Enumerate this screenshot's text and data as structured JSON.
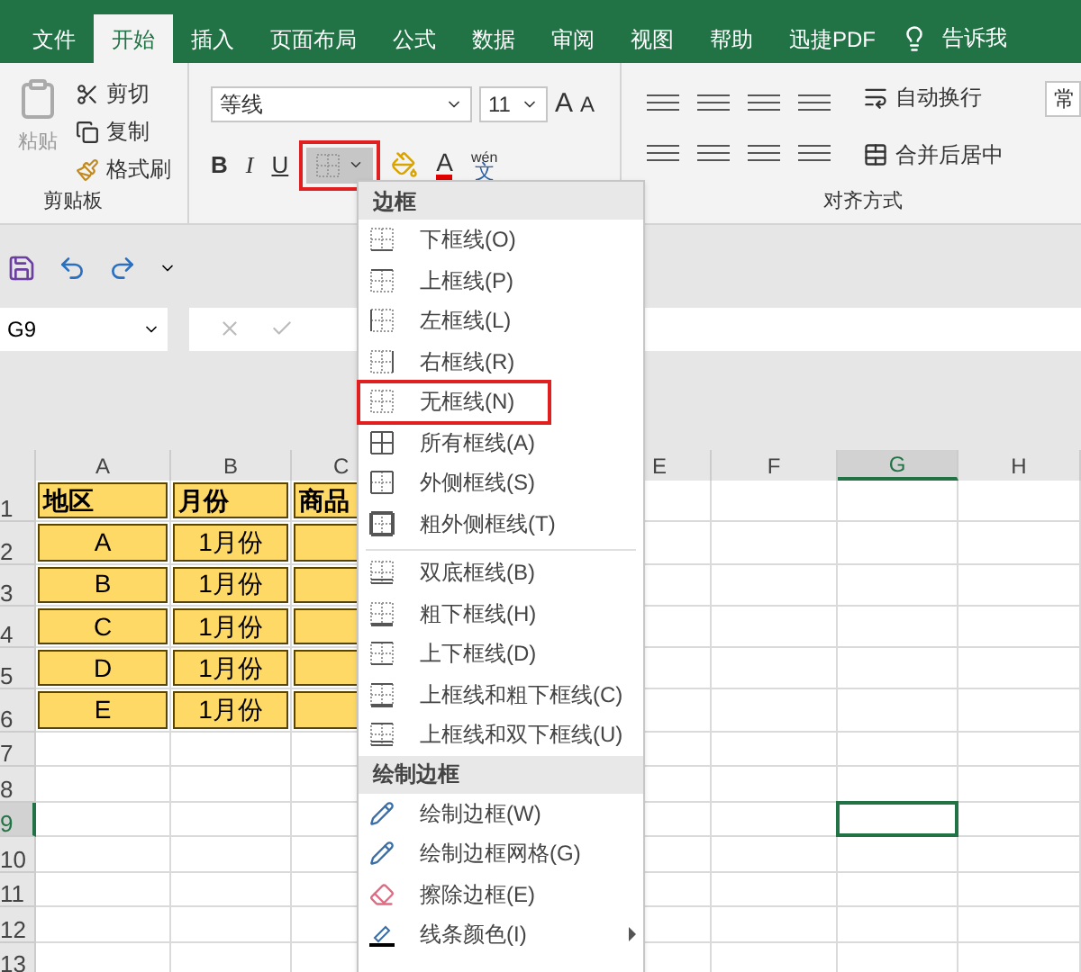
{
  "tabs": [
    {
      "label": "文件",
      "selected": false
    },
    {
      "label": "开始",
      "selected": true
    },
    {
      "label": "插入",
      "selected": false
    },
    {
      "label": "页面布局",
      "selected": false
    },
    {
      "label": "公式",
      "selected": false
    },
    {
      "label": "数据",
      "selected": false
    },
    {
      "label": "审阅",
      "selected": false
    },
    {
      "label": "视图",
      "selected": false
    },
    {
      "label": "帮助",
      "selected": false
    },
    {
      "label": "迅捷PDF",
      "selected": false
    }
  ],
  "tell_me": "告诉我",
  "ribbon": {
    "clipboard": {
      "paste": "粘贴",
      "cut": "剪切",
      "copy": "复制",
      "format_painter": "格式刷",
      "label": "剪贴板"
    },
    "font": {
      "name": "等线",
      "size": "11",
      "grow": "A",
      "shrink": "A",
      "bold": "B",
      "italic": "I",
      "underline": "U",
      "font_color": "A",
      "phonetic_top": "wén",
      "phonetic": "文",
      "border_highlighted": true
    },
    "alignment": {
      "wrap": "自动换行",
      "merge": "合并后居中",
      "label": "对齐方式"
    },
    "next_group": "常"
  },
  "name_box": "G9",
  "columns": [
    {
      "label": "A",
      "selected": false
    },
    {
      "label": "B",
      "selected": false
    },
    {
      "label": "C",
      "selected": false
    },
    {
      "label": "E",
      "selected": false
    },
    {
      "label": "F",
      "selected": false
    },
    {
      "label": "G",
      "selected": true
    },
    {
      "label": "H",
      "selected": false
    }
  ],
  "rows": [
    {
      "label": "1",
      "selected": false,
      "cells": [
        "地区",
        "月份",
        "商品"
      ]
    },
    {
      "label": "2",
      "selected": false,
      "cells": [
        "A",
        "1月份",
        ""
      ]
    },
    {
      "label": "3",
      "selected": false,
      "cells": [
        "B",
        "1月份",
        ""
      ]
    },
    {
      "label": "4",
      "selected": false,
      "cells": [
        "C",
        "1月份",
        ""
      ]
    },
    {
      "label": "5",
      "selected": false,
      "cells": [
        "D",
        "1月份",
        ""
      ]
    },
    {
      "label": "6",
      "selected": false,
      "cells": [
        "E",
        "1月份",
        ""
      ]
    },
    {
      "label": "7",
      "selected": false,
      "cells": []
    },
    {
      "label": "8",
      "selected": false,
      "cells": []
    },
    {
      "label": "9",
      "selected": true,
      "cells": []
    },
    {
      "label": "10",
      "selected": false,
      "cells": []
    },
    {
      "label": "11",
      "selected": false,
      "cells": []
    },
    {
      "label": "12",
      "selected": false,
      "cells": []
    },
    {
      "label": "13",
      "selected": false,
      "cells": []
    }
  ],
  "border_menu": [
    {
      "kind": "header",
      "label": "边框"
    },
    {
      "kind": "bottom",
      "label": "下框线(O)",
      "highlighted": false
    },
    {
      "kind": "top",
      "label": "上框线(P)",
      "highlighted": false
    },
    {
      "kind": "left",
      "label": "左框线(L)",
      "highlighted": false
    },
    {
      "kind": "right",
      "label": "右框线(R)",
      "highlighted": false
    },
    {
      "kind": "none",
      "label": "无框线(N)",
      "highlighted": true
    },
    {
      "kind": "all",
      "label": "所有框线(A)",
      "highlighted": false
    },
    {
      "kind": "outside",
      "label": "外侧框线(S)",
      "highlighted": false
    },
    {
      "kind": "thick-outside",
      "label": "粗外侧框线(T)",
      "highlighted": false
    },
    {
      "kind": "separator"
    },
    {
      "kind": "double-bottom",
      "label": "双底框线(B)",
      "highlighted": false
    },
    {
      "kind": "thick-bottom",
      "label": "粗下框线(H)",
      "highlighted": false
    },
    {
      "kind": "top-bottom",
      "label": "上下框线(D)",
      "highlighted": false
    },
    {
      "kind": "top-thick-bottom",
      "label": "上框线和粗下框线(C)",
      "highlighted": false
    },
    {
      "kind": "top-double-bottom",
      "label": "上框线和双下框线(U)",
      "highlighted": false
    },
    {
      "kind": "header",
      "label": "绘制边框"
    },
    {
      "kind": "draw",
      "label": "绘制边框(W)",
      "highlighted": false
    },
    {
      "kind": "draw-grid",
      "label": "绘制边框网格(G)",
      "highlighted": false
    },
    {
      "kind": "erase",
      "label": "擦除边框(E)",
      "highlighted": false
    },
    {
      "kind": "line-color",
      "label": "线条颜色(I)",
      "highlighted": false,
      "submenu": true
    }
  ]
}
